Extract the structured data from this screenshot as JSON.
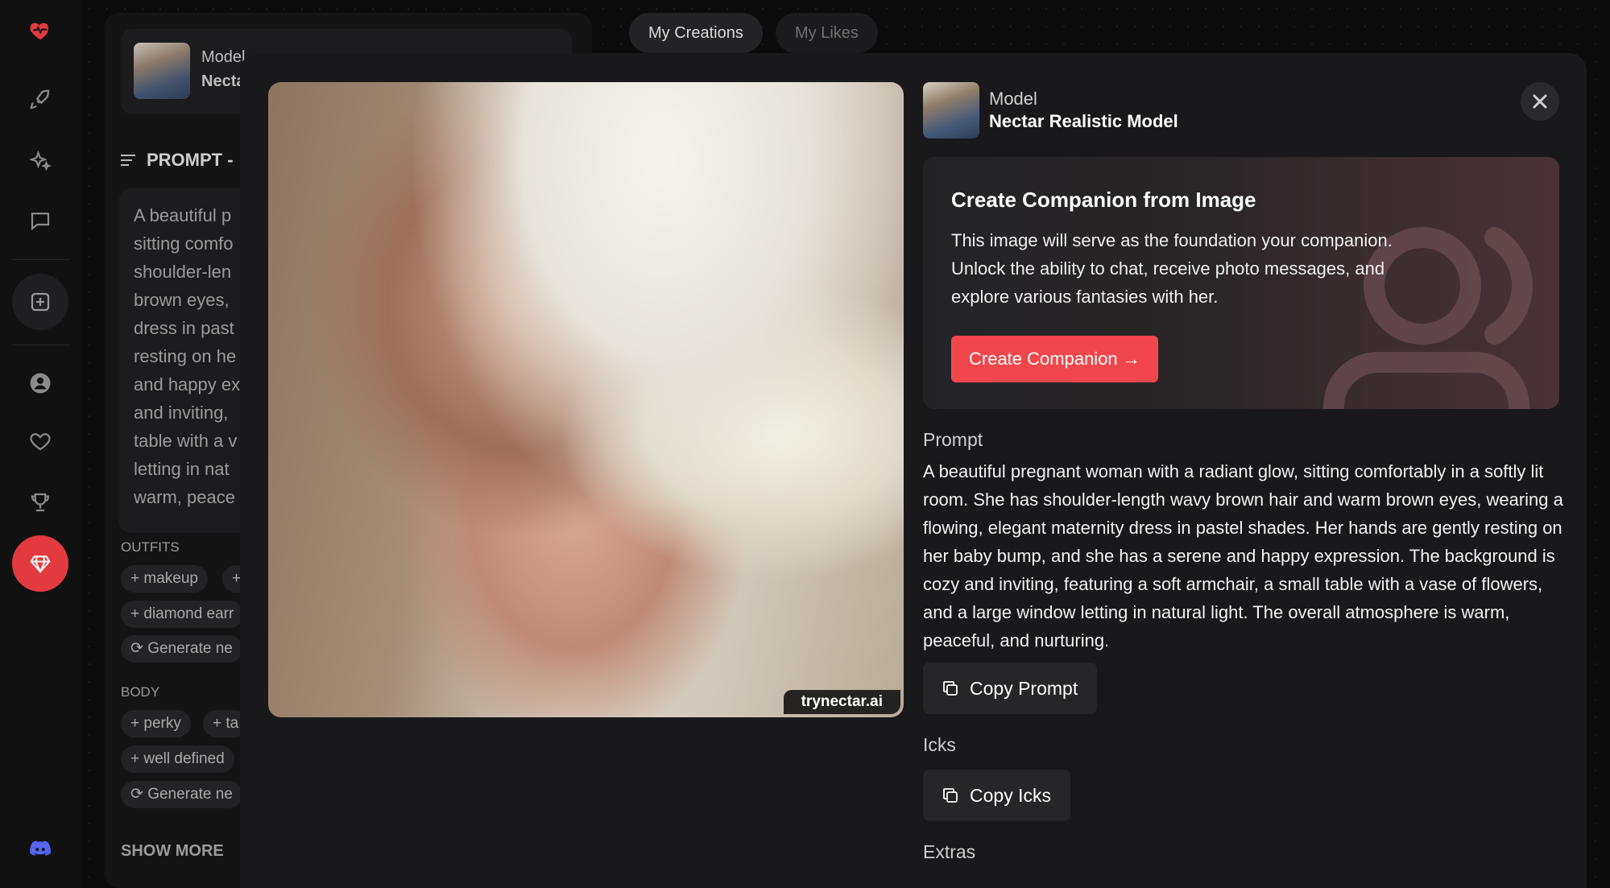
{
  "sidebar_rail": {
    "items": [
      {
        "name": "logo-heart-icon"
      },
      {
        "name": "rocket-icon"
      },
      {
        "name": "sparkles-icon"
      },
      {
        "name": "chat-icon"
      },
      {
        "name": "create-plus-icon"
      },
      {
        "name": "profile-icon"
      },
      {
        "name": "likes-heart-icon"
      },
      {
        "name": "trophy-icon"
      },
      {
        "name": "premium-gem-icon"
      },
      {
        "name": "discord-icon"
      }
    ],
    "accent": "#e23a3f"
  },
  "tabs": [
    {
      "label": "My Creations",
      "active": true
    },
    {
      "label": "My Likes",
      "active": false
    }
  ],
  "side_panel": {
    "model_label": "Model",
    "model_name": "Necta",
    "prompt_heading": "PROMPT -",
    "prompt_lines": [
      "A beautiful p",
      "sitting comfo",
      "shoulder-len",
      "brown eyes,",
      "dress in past",
      "resting on he",
      "and happy ex",
      "and inviting,",
      "table with a v",
      "letting in nat",
      "warm, peace"
    ],
    "outfits_label": "OUTFITS",
    "outfit_chips": [
      "+ makeup",
      "+",
      "+ diamond earr",
      "Generate ne"
    ],
    "body_label": "BODY",
    "body_chips": [
      "+ perky",
      "+ ta",
      "+ well defined",
      "Generate ne"
    ],
    "show_more": "SHOW MORE"
  },
  "modal": {
    "image_watermark": "trynectar.ai",
    "model_label": "Model",
    "model_name": "Nectar Realistic Model",
    "companion_card": {
      "title": "Create Companion from Image",
      "description": "This image will serve as the foundation your companion. Unlock the ability to chat, receive photo messages, and explore various fantasies with her.",
      "button": "Create Companion →",
      "button_color": "#f1474c"
    },
    "prompt_label": "Prompt",
    "prompt_text": "A beautiful pregnant woman with a radiant glow, sitting comfortably in a softly lit room. She has shoulder-length wavy brown hair and warm brown eyes, wearing a flowing, elegant maternity dress in pastel shades. Her hands are gently resting on her baby bump, and she has a serene and happy expression. The background is cozy and inviting, featuring a soft armchair, a small table with a vase of flowers, and a large window letting in natural light. The overall atmosphere is warm, peaceful, and nurturing.",
    "copy_prompt_button": "Copy Prompt",
    "icks_label": "Icks",
    "copy_icks_button": "Copy Icks",
    "extras_label": "Extras"
  }
}
